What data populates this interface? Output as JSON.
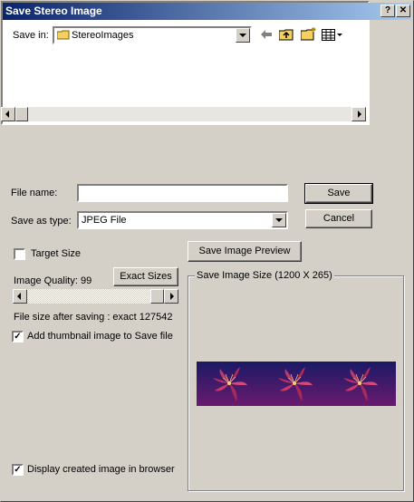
{
  "window": {
    "title": "Save Stereo Image"
  },
  "titlebar_buttons": {
    "help": "?",
    "close": "✕"
  },
  "save_in": {
    "label": "Save in:",
    "value": "StereoImages"
  },
  "toolbar": {
    "back_icon": "back-arrow-icon",
    "up_icon": "up-folder-icon",
    "new_folder_icon": "new-folder-icon",
    "view_icon": "view-menu-icon"
  },
  "file_name": {
    "label": "File name:",
    "value": ""
  },
  "save_as_type": {
    "label": "Save as type:",
    "value": "JPEG File"
  },
  "buttons": {
    "save": "Save",
    "cancel": "Cancel",
    "save_image_preview": "Save Image Preview",
    "exact_sizes": "Exact Sizes"
  },
  "target_size": {
    "label": "Target Size",
    "checked": false
  },
  "image_quality": {
    "label": "Image Quality: 99",
    "value": 99
  },
  "file_size_text": "File size after saving : exact 127542",
  "add_thumbnail": {
    "label": "Add thumbnail image to Save file",
    "checked": true
  },
  "display_in_browser": {
    "label": "Display created image in browser",
    "checked": true
  },
  "preview_group": {
    "label": "Save Image Size (1200 X 265)"
  },
  "colors": {
    "title_start": "#0a246a",
    "title_end": "#a6caf0",
    "face": "#d4d0c8",
    "preview_top": "#1a1a66",
    "preview_bottom": "#6a1a6e",
    "flower": "#c03a6a"
  }
}
